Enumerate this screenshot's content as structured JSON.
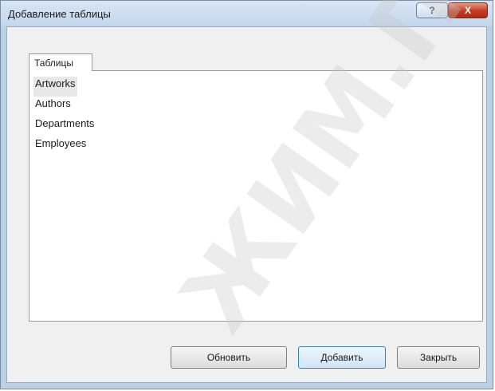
{
  "window": {
    "title": "Добавление таблицы",
    "help_label": "?",
    "close_label": "X"
  },
  "tabs": [
    {
      "label": "Таблицы",
      "selected": true
    }
  ],
  "tables": {
    "items": [
      {
        "label": "Artworks",
        "selected": true
      },
      {
        "label": "Authors",
        "selected": false
      },
      {
        "label": "Departments",
        "selected": false
      },
      {
        "label": "Employees",
        "selected": false
      }
    ]
  },
  "buttons": {
    "refresh_label": "Обновить",
    "add_label": "Добавить",
    "close_label": "Закрыть"
  },
  "watermark": {
    "text": "ЖИМ.П"
  }
}
